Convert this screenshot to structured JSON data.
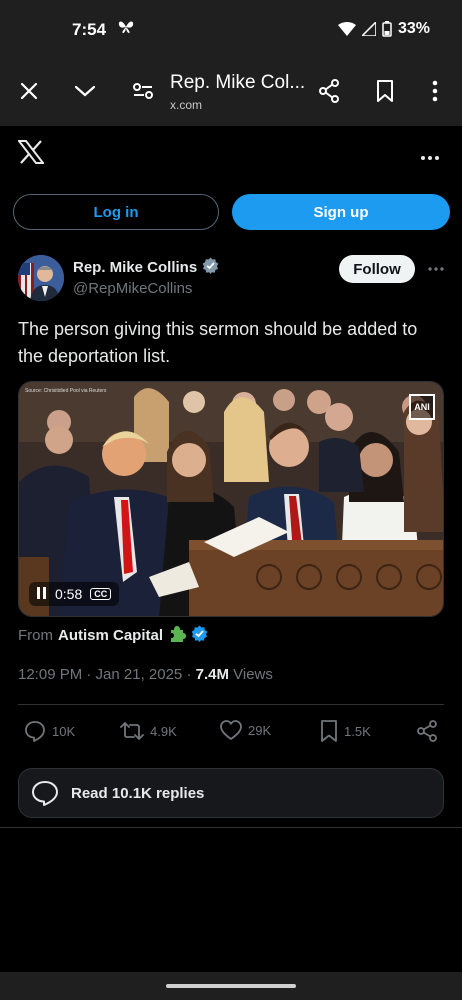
{
  "status": {
    "time": "7:54",
    "battery": "33%"
  },
  "browser": {
    "title": "Rep. Mike Col...",
    "url": "x.com"
  },
  "auth": {
    "login_label": "Log in",
    "signup_label": "Sign up"
  },
  "tweet": {
    "author_name": "Rep. Mike Collins",
    "author_handle": "@RepMikeCollins",
    "follow_label": "Follow",
    "text": "The person giving this sermon should be added to the deportation list.",
    "video": {
      "time": "0:58",
      "cc": "CC",
      "source_text": "Source: Chrisitidied Pool via Reuters",
      "logo": "ANI"
    },
    "from_prefix": "From",
    "from_name": "Autism Capital",
    "time": "12:09 PM · Jan 21, 2025 · ",
    "views_count": "7.4M",
    "views_label": "Views",
    "replies": "10K",
    "reposts": "4.9K",
    "likes": "29K",
    "bookmarks": "1.5K",
    "read_replies_label": "Read 10.1K replies"
  },
  "colors": {
    "accent": "#1d9bf0",
    "verified": "#1d9bf0",
    "background": "#000000"
  }
}
